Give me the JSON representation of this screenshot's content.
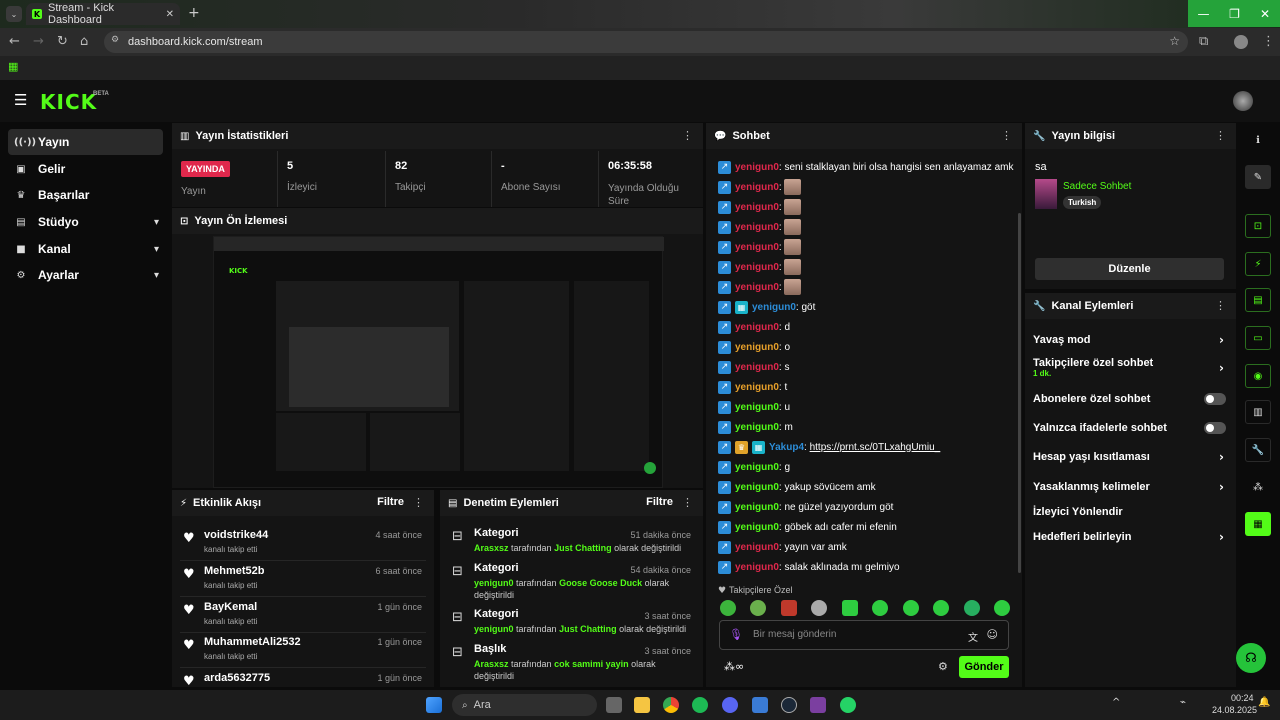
{
  "browser": {
    "tab_title": "Stream - Kick Dashboard",
    "url": "dashboard.kick.com/stream"
  },
  "header": {
    "logo": "KICK",
    "beta": "BETA"
  },
  "sidebar": {
    "items": [
      {
        "label": "Yayın",
        "icon": "broadcast-icon"
      },
      {
        "label": "Gelir",
        "icon": "revenue-icon"
      },
      {
        "label": "Başarılar",
        "icon": "trophy-icon"
      },
      {
        "label": "Stüdyo",
        "icon": "studio-icon"
      },
      {
        "label": "Kanal",
        "icon": "channel-icon"
      },
      {
        "label": "Ayarlar",
        "icon": "gear-icon"
      }
    ]
  },
  "stats": {
    "title": "Yayın İstatistikleri",
    "live_badge": "YAYINDA",
    "items": [
      {
        "value": "",
        "label": "Yayın"
      },
      {
        "value": "5",
        "label": "İzleyici"
      },
      {
        "value": "82",
        "label": "Takipçi"
      },
      {
        "value": "-",
        "label": "Abone Sayısı"
      },
      {
        "value": "06:35:58",
        "label": "Yayında Olduğu Süre"
      }
    ]
  },
  "preview": {
    "title": "Yayın Ön İzlemesi"
  },
  "activity": {
    "title": "Etkinlik Akışı",
    "filter": "Filtre",
    "items": [
      {
        "name": "voidstrike44",
        "sub": "kanalı takip etti",
        "time": "4 saat önce"
      },
      {
        "name": "Mehmet52b",
        "sub": "kanalı takip etti",
        "time": "6 saat önce"
      },
      {
        "name": "BayKemal",
        "sub": "kanalı takip etti",
        "time": "1 gün önce"
      },
      {
        "name": "MuhammetAli2532",
        "sub": "kanalı takip etti",
        "time": "1 gün önce"
      },
      {
        "name": "arda5632775",
        "sub": "",
        "time": "1 gün önce"
      }
    ]
  },
  "moderation": {
    "title": "Denetim Eylemleri",
    "filter": "Filtre",
    "items": [
      {
        "title": "Kategori",
        "time": "51 dakika önce",
        "user": "Arasxsz",
        "mid": " tarafından ",
        "target": "Just Chatting",
        "end": " olarak değiştirildi"
      },
      {
        "title": "Kategori",
        "time": "54 dakika önce",
        "user": "yenigun0",
        "mid": " tarafından ",
        "target": "Goose Goose Duck",
        "end": " olarak değiştirildi"
      },
      {
        "title": "Kategori",
        "time": "3 saat önce",
        "user": "yenigun0",
        "mid": " tarafından ",
        "target": "Just Chatting",
        "end": " olarak değiştirildi"
      },
      {
        "title": "Başlık",
        "time": "3 saat önce",
        "user": "Arasxsz",
        "mid": " tarafından ",
        "target": "cok samimi yayin",
        "end": " olarak değiştirildi"
      }
    ]
  },
  "chat": {
    "title": "Sohbet",
    "messages": [
      {
        "user": "yenigun0",
        "text": "seni stalklayan biri olsa hangisi sen anlayamaz amk",
        "color": "#e0284c",
        "emote": false
      },
      {
        "user": "yenigun0",
        "text": "",
        "color": "#e0284c",
        "emote": true
      },
      {
        "user": "yenigun0",
        "text": "",
        "color": "#e0284c",
        "emote": true
      },
      {
        "user": "yenigun0",
        "text": "",
        "color": "#e0284c",
        "emote": true
      },
      {
        "user": "yenigun0",
        "text": "",
        "color": "#e0284c",
        "emote": true
      },
      {
        "user": "yenigun0",
        "text": "",
        "color": "#e0284c",
        "emote": true
      },
      {
        "user": "yenigun0",
        "text": "",
        "color": "#e0284c",
        "emote": true
      },
      {
        "user": "yenigun0",
        "text": "göt",
        "color": "#2c8dd8",
        "emote": false
      },
      {
        "user": "yenigun0",
        "text": "d",
        "color": "#e0284c",
        "emote": false
      },
      {
        "user": "yenigun0",
        "text": "o",
        "color": "#e8a02a",
        "emote": false
      },
      {
        "user": "yenigun0",
        "text": "s",
        "color": "#e0284c",
        "emote": false
      },
      {
        "user": "yenigun0",
        "text": "t",
        "color": "#e8a02a",
        "emote": false
      },
      {
        "user": "yenigun0",
        "text": "u",
        "color": "#53fc18",
        "emote": false
      },
      {
        "user": "yenigun0",
        "text": "m",
        "color": "#53fc18",
        "emote": false
      },
      {
        "user": "Yakup4",
        "text": "https://prnt.sc/0TLxahgUmiu_",
        "color": "#2c8dd8",
        "emote": false
      },
      {
        "user": "yenigun0",
        "text": "g",
        "color": "#53fc18",
        "emote": false
      },
      {
        "user": "yenigun0",
        "text": "yakup sövücem amk",
        "color": "#53fc18",
        "emote": false
      },
      {
        "user": "yenigun0",
        "text": "ne güzel yazıyordum göt",
        "color": "#53fc18",
        "emote": false
      },
      {
        "user": "yenigun0",
        "text": "göbek adı cafer mi efenin",
        "color": "#53fc18",
        "emote": false
      },
      {
        "user": "yenigun0",
        "text": "yayın var amk",
        "color": "#e0284c",
        "emote": false
      },
      {
        "user": "yenigun0",
        "text": "salak aklınada mı gelmiyo",
        "color": "#e0284c",
        "emote": false
      }
    ],
    "followers_only": "Takipçilere Özel",
    "input_placeholder": "Bir mesaj gönderin",
    "send": "Gönder",
    "colon": ": "
  },
  "stream_info": {
    "title": "Yayın bilgisi",
    "stream_title": "sa",
    "category": "Sadece Sohbet",
    "tag": "Turkish",
    "edit": "Düzenle"
  },
  "channel_actions": {
    "title": "Kanal Eylemleri",
    "slow_mode": "Yavaş mod",
    "followers_chat": "Takipçilere özel sohbet",
    "followers_chat_value": "1 dk.",
    "subs_chat": "Abonelere özel sohbet",
    "emote_chat": "Yalnızca ifadelerle sohbet",
    "age_limits": "Hesap yaşı kısıtlaması",
    "banned_words": "Yasaklanmış kelimeler",
    "redirect": "İzleyici Yönlendir",
    "goals": "Hedefleri belirleyin"
  },
  "taskbar": {
    "search": "Ara",
    "time": "00:24",
    "date": "24.08.2025"
  }
}
